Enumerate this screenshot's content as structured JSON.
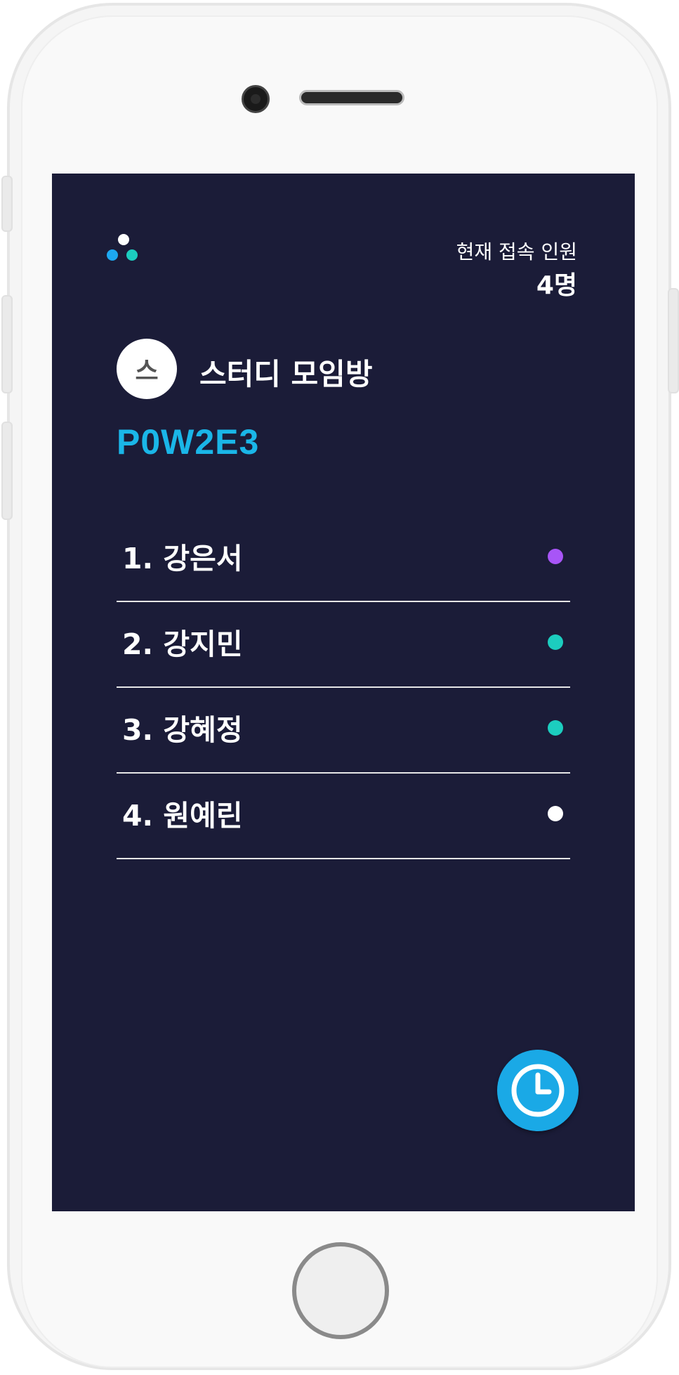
{
  "header": {
    "online_label": "현재 접속 인원",
    "online_count": "4명"
  },
  "room": {
    "avatar_initial": "스",
    "title": "스터디 모임방",
    "code": "P0W2E3"
  },
  "members": [
    {
      "label": "1. 강은서",
      "status_color": "#a855f7"
    },
    {
      "label": "2. 강지민",
      "status_color": "#1ccdbf"
    },
    {
      "label": "3. 강혜정",
      "status_color": "#1ccdbf"
    },
    {
      "label": "4. 원예린",
      "status_color": "#ffffff"
    }
  ],
  "icons": {
    "logo": "three-dots-logo-icon",
    "timer": "clock-icon"
  },
  "colors": {
    "background": "#1b1c38",
    "accent": "#1ab6e8",
    "logo_dots": [
      "#ffffff",
      "#1da8f0",
      "#1ccdbf"
    ]
  }
}
